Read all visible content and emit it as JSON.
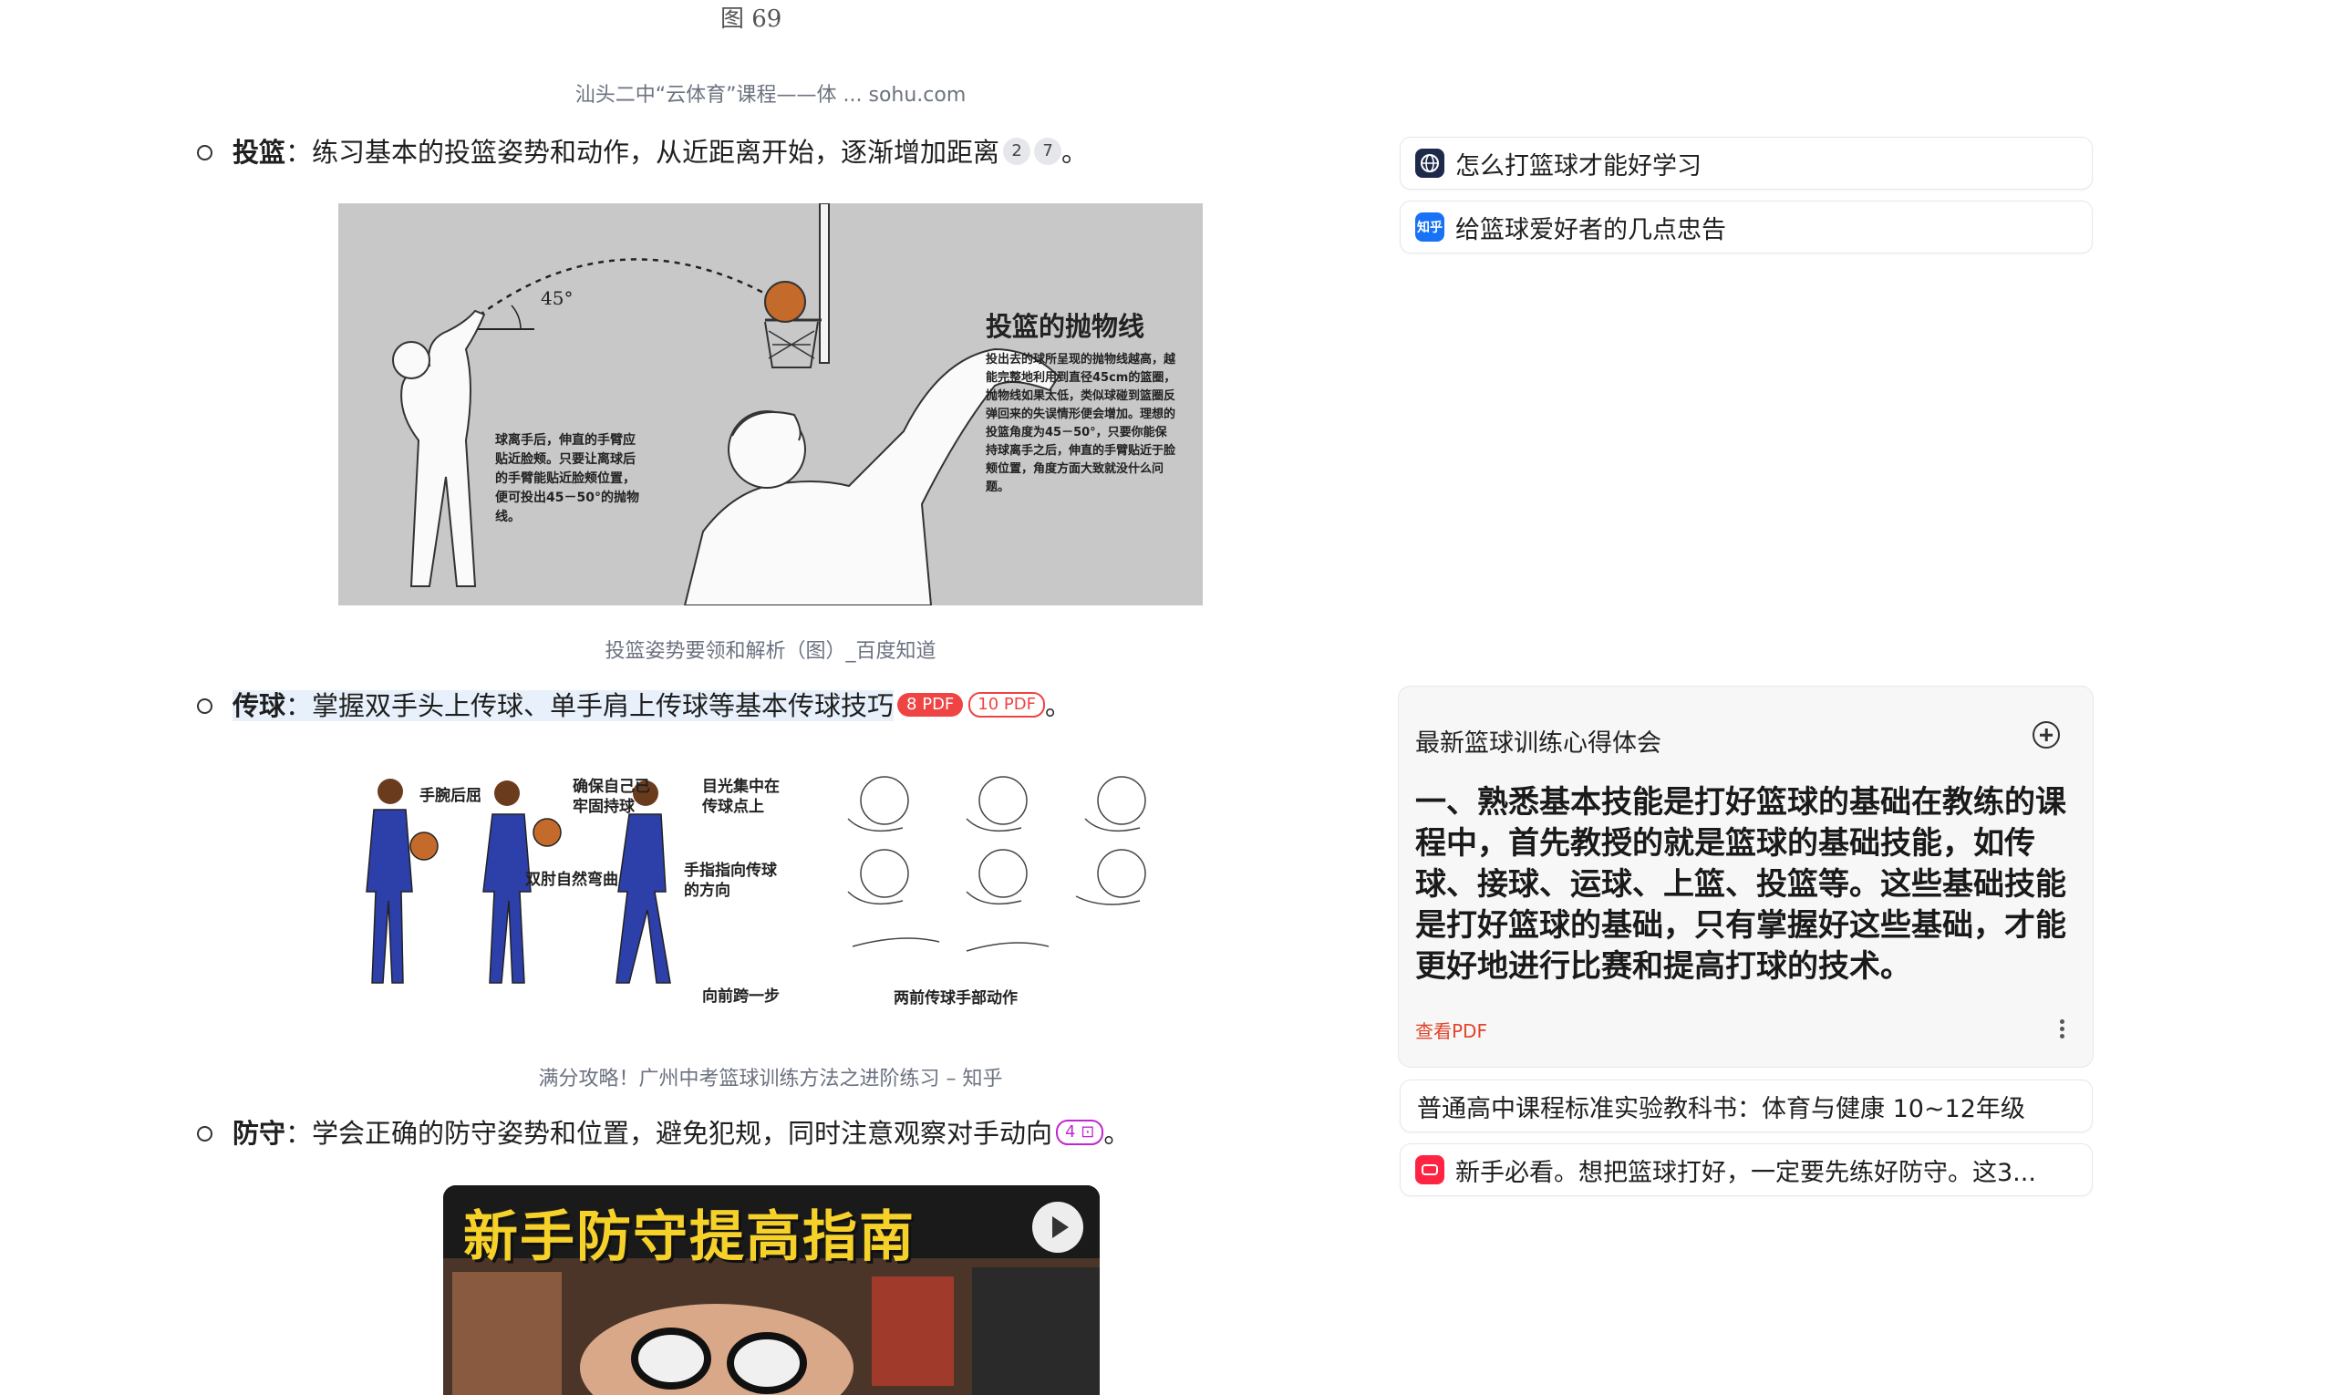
{
  "figure_label_top": "图 69",
  "caption_1": "汕头二中“云体育”课程——体 ... sohu.com",
  "bullets": [
    {
      "title": "投篮",
      "sep": "：",
      "text": "练习基本的投篮姿势和动作，从近距离开始，逐渐增加距离",
      "cites": [
        "2",
        "7"
      ],
      "end": "。"
    },
    {
      "title": "传球",
      "sep": "：",
      "text": "掌握双手头上传球、单手肩上传球等基本传球技巧",
      "pdf_a": "8 PDF",
      "pdf_b": "10 PDF",
      "end": "。"
    },
    {
      "title": "防守",
      "sep": "：",
      "text": "学会正确的防守姿势和位置，避免犯规，同时注意观察对手动向",
      "cite_pink": "4",
      "end": "。"
    }
  ],
  "figure_1": {
    "angle_label": "45°",
    "heading": "投篮的抛物线",
    "left_note": "球离手后，伸直的手臂应贴近脸颊。只要让离球后的手臂能贴近脸颊位置，便可投出45－50°的抛物线。",
    "right_note": "投出去的球所呈现的抛物线越高，越能完整地利用到直径45cm的篮圈，抛物线如果太低，类似球碰到篮圈反弹回来的失误情形便会增加。理想的投篮角度为45－50°，只要你能保持球离手之后，伸直的手臂贴近于脸颊位置，角度方面大致就没什么问题。"
  },
  "caption_2": "投篮姿势要领和解析（图）_百度知道",
  "figure_2": {
    "labels": [
      "手腕后屈",
      "确保自己已牢固持球",
      "目光集中在传球点上",
      "双肘自然弯曲",
      "手指指向传球的方向",
      "向前跨一步",
      "两前传球手部动作"
    ]
  },
  "caption_3": "满分攻略！广州中考篮球训练方法之进阶练习 – 知乎",
  "video_title": "新手防守提高指南",
  "right_panel": {
    "links": [
      {
        "icon": "globe-icon",
        "label": "怎么打篮球才能好学习"
      },
      {
        "icon": "zhihu-icon",
        "icon_text": "知乎",
        "label": "给篮球爱好者的几点忠告"
      }
    ],
    "note": {
      "title": "最新篮球训练心得体会",
      "body": "一、熟悉基本技能是打好篮球的基础在教练的课程中，首先教授的就是篮球的基础技能，如传球、接球、运球、上篮、投篮等。这些基础技能是打好篮球的基础，只有掌握好这些基础，才能更好地进行比赛和提高打球的技术。",
      "link": "查看PDF"
    },
    "bottom_links": [
      {
        "label": "普通高中课程标准实验教科书：体育与健康 10~12年级"
      },
      {
        "icon": "xiaohongshu-icon",
        "label": "新手必看。想把篮球打好，一定要先练好防守。这3..."
      }
    ]
  },
  "colors": {
    "accent_red": "#ef4444",
    "link_red": "#e0452b",
    "pink": "#c026d3",
    "highlight": "#e8f1fb"
  }
}
